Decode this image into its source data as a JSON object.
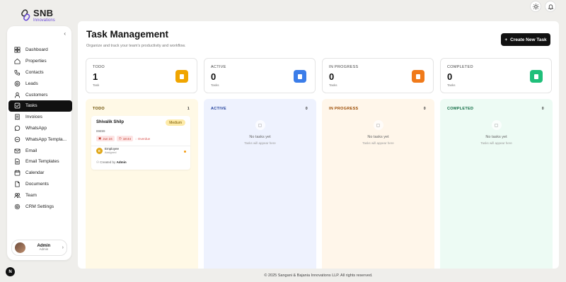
{
  "brand": {
    "title": "SNB",
    "subtitle": "Innovations",
    "accent": "#6a4bd6"
  },
  "top_icons": [
    {
      "icon": "sun-icon"
    },
    {
      "icon": "bell-icon"
    }
  ],
  "sidebar": {
    "collapse_icon": "chevron-left-icon",
    "items": [
      {
        "label": "Dashboard",
        "icon": "dashboard-icon",
        "active": false
      },
      {
        "label": "Properties",
        "icon": "home-icon",
        "active": false
      },
      {
        "label": "Contacts",
        "icon": "phone-icon",
        "active": false
      },
      {
        "label": "Leads",
        "icon": "leads-icon",
        "active": false
      },
      {
        "label": "Customers",
        "icon": "user-icon",
        "active": false
      },
      {
        "label": "Tasks",
        "icon": "checkbox-icon",
        "active": true
      },
      {
        "label": "Invoices",
        "icon": "invoice-icon",
        "active": false
      },
      {
        "label": "WhatsApp",
        "icon": "whatsapp-icon",
        "active": false
      },
      {
        "label": "WhatsApp Templa...",
        "icon": "whatsapp-template-icon",
        "active": false
      },
      {
        "label": "Email",
        "icon": "mail-icon",
        "active": false
      },
      {
        "label": "Email Templates",
        "icon": "document-icon",
        "active": false
      },
      {
        "label": "Calendar",
        "icon": "calendar-icon",
        "active": false
      },
      {
        "label": "Documents",
        "icon": "file-icon",
        "active": false
      },
      {
        "label": "Team",
        "icon": "team-icon",
        "active": false
      },
      {
        "label": "CRM Settings",
        "icon": "gear-icon",
        "active": false
      }
    ],
    "user": {
      "name": "Admin",
      "role": "Admin"
    }
  },
  "bottom_badge": "N",
  "main": {
    "title": "Task Management",
    "subtitle": "Organize and track your team's productivity and workflow.",
    "create_button": "Create New Task",
    "stats": [
      {
        "label": "TODO",
        "value": "1",
        "unit": "Task",
        "color": "#f0a500"
      },
      {
        "label": "ACTIVE",
        "value": "0",
        "unit": "Tasks",
        "color": "#3b7de9"
      },
      {
        "label": "IN PROGRESS",
        "value": "0",
        "unit": "Tasks",
        "color": "#f07a1a"
      },
      {
        "label": "COMPLETED",
        "value": "0",
        "unit": "Tasks",
        "color": "#1fbf7a"
      }
    ],
    "columns": [
      {
        "title": "TODO",
        "count": "1",
        "bg": "#fff9e6",
        "color": "#6b4e00"
      },
      {
        "title": "ACTIVE",
        "count": "0",
        "bg": "#eef2fe",
        "color": "#1f3e9a",
        "empty_title": "No tasks yet",
        "empty_sub": "Tasks will appear here"
      },
      {
        "title": "IN PROGRESS",
        "count": "0",
        "bg": "#fff6ea",
        "color": "#9a4a00",
        "empty_title": "No tasks yet",
        "empty_sub": "Tasks will appear here"
      },
      {
        "title": "COMPLETED",
        "count": "0",
        "bg": "#edfbf4",
        "color": "#0e6b42",
        "empty_title": "No tasks yet",
        "empty_sub": "Tasks will appear here"
      }
    ],
    "task": {
      "title": "Shivalik Shilp",
      "priority": "Medium",
      "description": "89899",
      "date": "Jun 24",
      "time": "18:44",
      "overdue": "Overdue",
      "assignee_initial": "E",
      "assignee_name": "Employee",
      "assignee_status": "Assigned",
      "created_prefix": "Created by",
      "created_by": "Admin"
    }
  },
  "footer": {
    "text": "© 2025 Sangani & Bajania Innovations LLP.  All rights reserved."
  }
}
